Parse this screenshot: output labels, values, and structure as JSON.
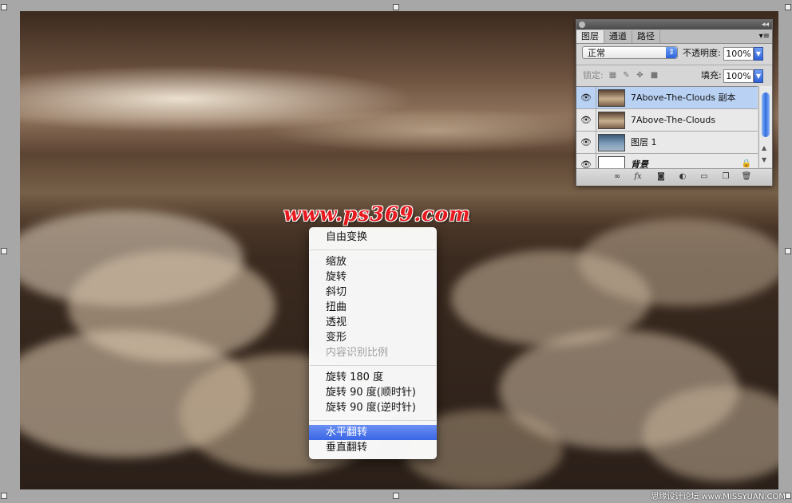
{
  "watermark": "www.ps369.com",
  "credit": "思缘设计论坛 www.MISSYUAN.COM",
  "context_menu": {
    "items": [
      {
        "label": "自由变换",
        "state": "normal"
      },
      {
        "label": "缩放",
        "state": "normal"
      },
      {
        "label": "旋转",
        "state": "normal"
      },
      {
        "label": "斜切",
        "state": "normal"
      },
      {
        "label": "扭曲",
        "state": "normal"
      },
      {
        "label": "透视",
        "state": "normal"
      },
      {
        "label": "变形",
        "state": "normal"
      },
      {
        "label": "内容识别比例",
        "state": "disabled"
      },
      {
        "label": "旋转 180 度",
        "state": "normal"
      },
      {
        "label": "旋转 90 度(顺时针)",
        "state": "normal"
      },
      {
        "label": "旋转 90 度(逆时针)",
        "state": "normal"
      },
      {
        "label": "水平翻转",
        "state": "selected"
      },
      {
        "label": "垂直翻转",
        "state": "normal"
      }
    ]
  },
  "layers_panel": {
    "tabs": [
      "图层",
      "通道",
      "路径"
    ],
    "active_tab": "图层",
    "blend_mode": "正常",
    "opacity_label": "不透明度:",
    "opacity_value": "100%",
    "lock_label": "锁定:",
    "fill_label": "填充:",
    "fill_value": "100%",
    "layers": [
      {
        "name": "7Above-The-Clouds 副本",
        "selected": true
      },
      {
        "name": "7Above-The-Clouds",
        "selected": false
      },
      {
        "name": "图层 1",
        "selected": false
      },
      {
        "name": "背景",
        "selected": false
      }
    ],
    "footer_icons": [
      "link-icon",
      "fx-icon",
      "mask-icon",
      "adjustment-icon",
      "folder-icon",
      "new-layer-icon",
      "trash-icon"
    ]
  }
}
